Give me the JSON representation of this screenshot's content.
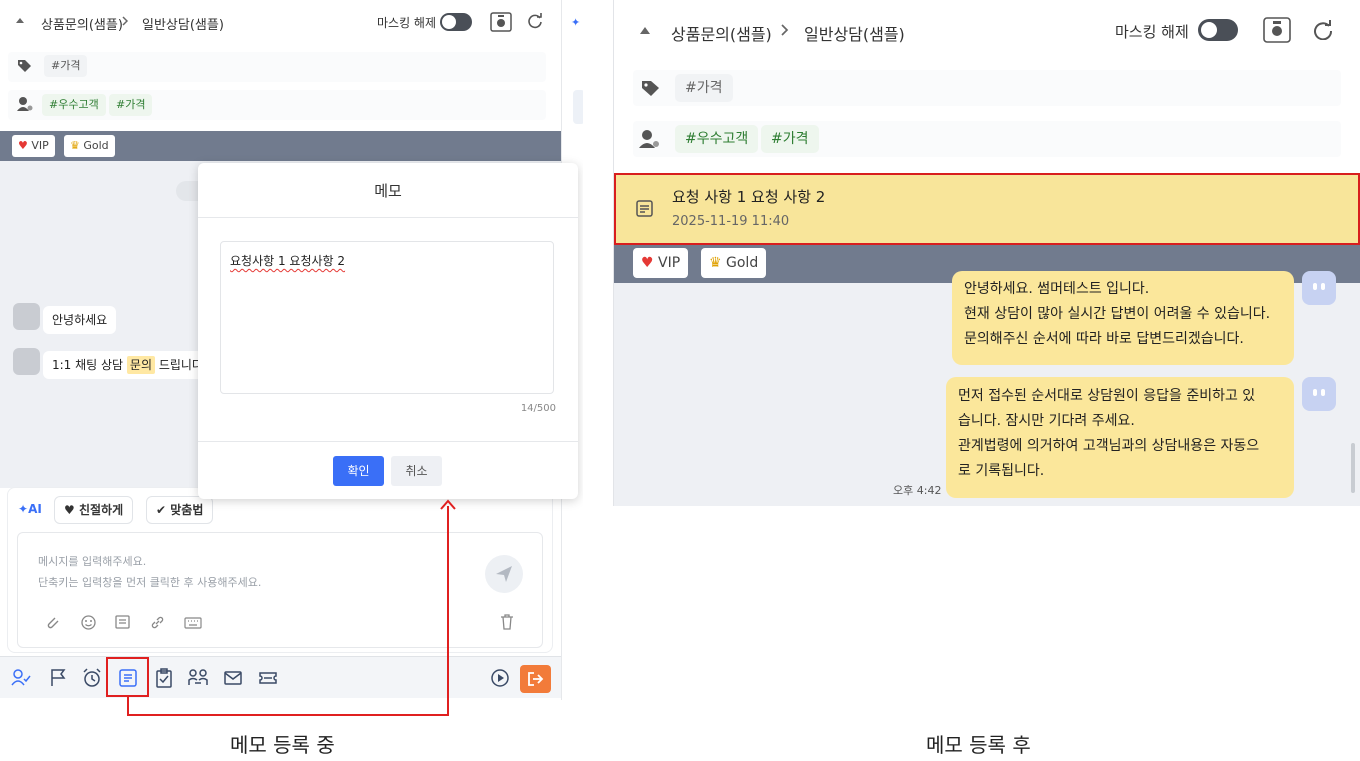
{
  "left": {
    "breadcrumb": {
      "category": "상품문의(샘플)",
      "subcategory": "일반상담(샘플)"
    },
    "masking_label": "마스킹 해제",
    "tag_row_1": [
      "#가격"
    ],
    "tag_row_2": [
      "#우수고객",
      "#가격"
    ],
    "badges": [
      "VIP",
      "Gold"
    ],
    "messages": [
      {
        "text": "안녕하세요"
      },
      {
        "prefix": "1:1 채팅 상담 ",
        "highlight": "문의",
        "suffix": " 드립니다."
      }
    ],
    "memo_modal": {
      "title": "메모",
      "text": "요청사항 1 요청사항 2",
      "count": "14/500",
      "confirm_label": "확인",
      "cancel_label": "취소"
    },
    "compose": {
      "ai_label": "AI",
      "chip_kind": "친절하게",
      "chip_spell": "맞춤법",
      "placeholder_line1": "메시지를 입력해주세요.",
      "placeholder_line2": "단축키는 입력창을 먼저 클릭한 후 사용해주세요."
    },
    "toolbar_icons": [
      "user-check-icon",
      "flag-icon",
      "alarm-clock-icon",
      "memo-icon",
      "clipboard-check-icon",
      "transfer-users-icon",
      "mail-icon",
      "ticket-icon",
      "play-circle-icon",
      "exit-icon"
    ],
    "caption": "메모 등록 중"
  },
  "right": {
    "breadcrumb": {
      "category": "상품문의(샘플)",
      "subcategory": "일반상담(샘플)"
    },
    "masking_label": "마스킹 해제",
    "tag_row_1": [
      "#가격"
    ],
    "tag_row_2": [
      "#우수고객",
      "#가격"
    ],
    "memo": {
      "text": "요청 사항 1 요청 사항 2",
      "timestamp": "2025-11-19 11:40"
    },
    "badges": [
      "VIP",
      "Gold"
    ],
    "messages": [
      {
        "lines": [
          "안녕하세요. 썸머테스트 입니다.",
          "현재 상담이 많아 실시간 답변이 어려울 수 있습니다.",
          "문의해주신 순서에 따라 바로 답변드리겠습니다."
        ]
      },
      {
        "lines": [
          "먼저 접수된 순서대로 상담원이 응답을 준비하고 있",
          "습니다. 잠시만 기다려 주세요.",
          "관계법령에 의거하여 고객님과의 상담내용은 자동으",
          "로 기록됩니다."
        ],
        "time": "오후 4:42"
      }
    ],
    "caption": "메모 등록 후"
  },
  "colors": {
    "accent": "#3a6ff7",
    "highlight_red": "#e02020",
    "memo_yellow": "#f8e59a",
    "badge_bar": "#717b8e",
    "exit_orange": "#f27b3a"
  }
}
